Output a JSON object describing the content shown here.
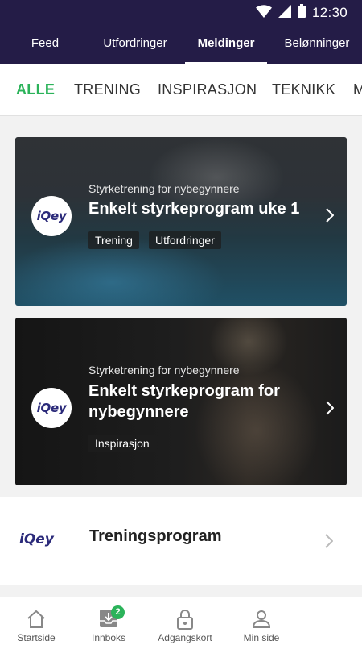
{
  "status_bar": {
    "time": "12:30"
  },
  "top_tabs": [
    {
      "label": "Feed",
      "active": false
    },
    {
      "label": "Utfordringer",
      "active": false
    },
    {
      "label": "Meldinger",
      "active": true
    },
    {
      "label": "Belønninger",
      "active": false
    }
  ],
  "categories": [
    {
      "label": "ALLE",
      "active": true
    },
    {
      "label": "TRENING",
      "active": false
    },
    {
      "label": "INSPIRASJON",
      "active": false
    },
    {
      "label": "TEKNIKK",
      "active": false
    },
    {
      "label": "M",
      "active": false
    }
  ],
  "cards": [
    {
      "logo": "iQey",
      "subtitle": "Styrketrening for nybegynnere",
      "title": "Enkelt styrkeprogram uke 1",
      "tags": [
        "Trening",
        "Utfordringer"
      ]
    },
    {
      "logo": "iQey",
      "subtitle": "Styrketrening for nybegynnere",
      "title_line1": "Enkelt styrkeprogram for",
      "title_line2": "nybegynnere",
      "tags": [
        "Inspirasjon"
      ]
    }
  ],
  "program_row": {
    "logo": "iQey",
    "title": "Treningsprogram"
  },
  "bottom_nav": [
    {
      "label": "Startside",
      "icon": "home-icon"
    },
    {
      "label": "Innboks",
      "icon": "inbox-icon",
      "badge": "2"
    },
    {
      "label": "Adgangskort",
      "icon": "lock-icon"
    },
    {
      "label": "Min side",
      "icon": "person-icon"
    }
  ],
  "colors": {
    "header_bg": "#241c47",
    "accent_green": "#2bb35a",
    "brand_navy": "#2b2a7a"
  }
}
